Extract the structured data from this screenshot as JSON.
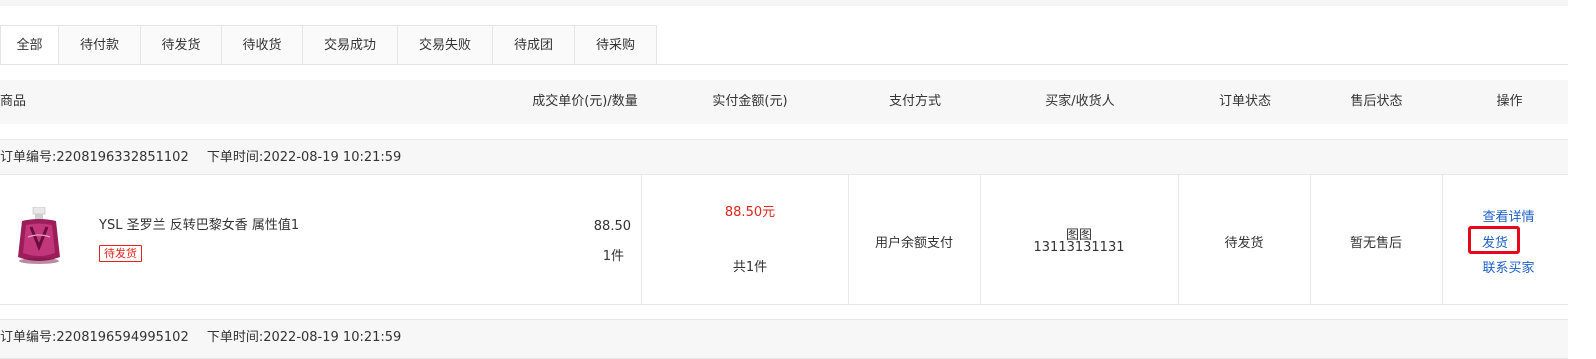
{
  "tabs": [
    "全部",
    "待付款",
    "待发货",
    "待收货",
    "交易成功",
    "交易失败",
    "待成团",
    "待采购"
  ],
  "active_tab": "全部",
  "table_headers": {
    "product": "商品",
    "unit_price_qty": "成交单价(元)/数量",
    "paid_amount": "实付金额(元)",
    "payment_method": "支付方式",
    "buyer": "买家/收货人",
    "order_status": "订单状态",
    "aftersale_status": "售后状态",
    "actions": "操作"
  },
  "orders": [
    {
      "order_no": "订单编号:2208196332851102",
      "order_time": "下单时间:2022-08-19 10:21:59",
      "product_name": "YSL 圣罗兰 反转巴黎女香 属性值1",
      "status_badge": "待发货",
      "price": "88.50",
      "quantity": "1件",
      "paid_amount": "88.50元",
      "total_items": "共1件",
      "payment_method": "用户余额支付",
      "buyer_name": "图图",
      "buyer_phone": "13113131131",
      "order_status": "待发货",
      "aftersale_status": "暂无售后",
      "actions": {
        "view_details": "查看详情",
        "ship": "发货",
        "contact_buyer": "联系买家"
      }
    },
    {
      "order_no": "订单编号:2208196594995102",
      "order_time": "下单时间:2022-08-19 10:21:59"
    }
  ],
  "colors": {
    "accent_red": "#e1251b",
    "link_blue": "#1e5fc4",
    "highlight_box": "#e8061b"
  }
}
